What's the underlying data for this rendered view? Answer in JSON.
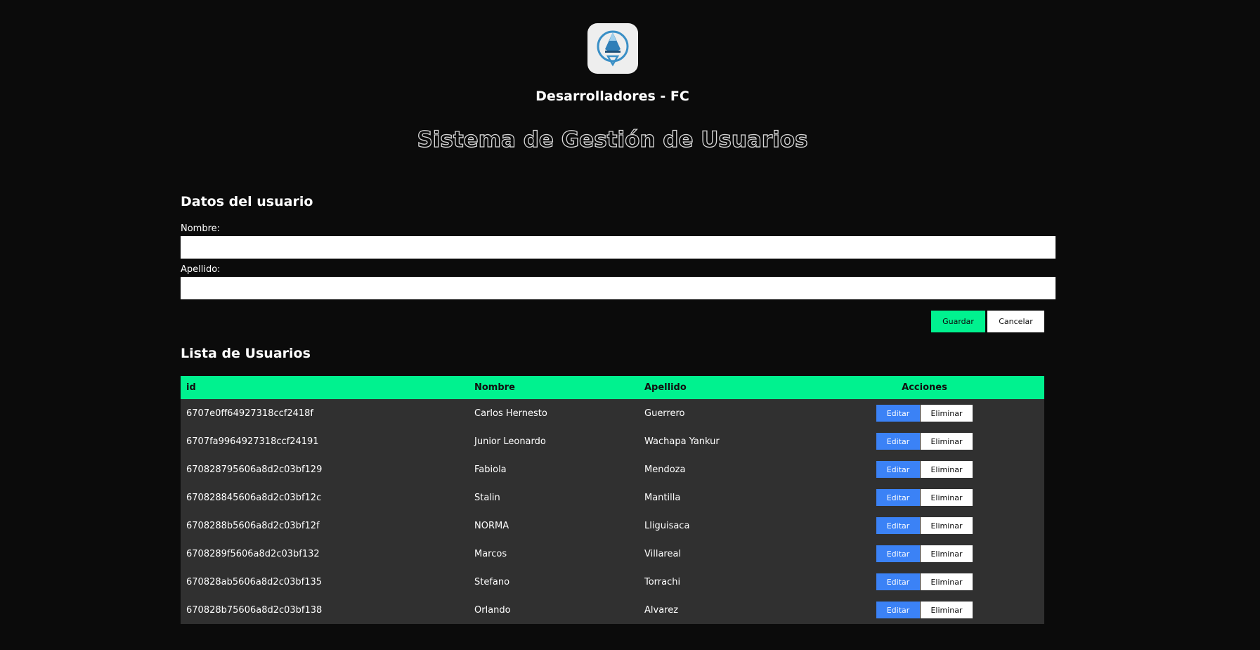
{
  "header": {
    "brand": "Desarrolladores - FC",
    "system_title": "Sistema de Gestión de Usuarios",
    "logo_icon": "droplet-shield-icon"
  },
  "form": {
    "title": "Datos del usuario",
    "nombre_label": "Nombre:",
    "nombre_value": "",
    "apellido_label": "Apellido:",
    "apellido_value": "",
    "save_label": "Guardar",
    "cancel_label": "Cancelar"
  },
  "list": {
    "title": "Lista de Usuarios",
    "columns": [
      "id",
      "Nombre",
      "Apellido",
      "Acciones"
    ],
    "edit_label": "Editar",
    "delete_label": "Eliminar",
    "rows": [
      {
        "id": "6707e0ff64927318ccf2418f",
        "nombre": "Carlos Hernesto",
        "apellido": "Guerrero"
      },
      {
        "id": "6707fa9964927318ccf24191",
        "nombre": "Junior Leonardo",
        "apellido": "Wachapa Yankur"
      },
      {
        "id": "670828795606a8d2c03bf129",
        "nombre": "Fabiola",
        "apellido": "Mendoza"
      },
      {
        "id": "670828845606a8d2c03bf12c",
        "nombre": "Stalin",
        "apellido": "Mantilla"
      },
      {
        "id": "6708288b5606a8d2c03bf12f",
        "nombre": "NORMA",
        "apellido": "Lliguisaca"
      },
      {
        "id": "6708289f5606a8d2c03bf132",
        "nombre": "Marcos",
        "apellido": "Villareal"
      },
      {
        "id": "670828ab5606a8d2c03bf135",
        "nombre": "Stefano",
        "apellido": "Torrachi"
      },
      {
        "id": "670828b75606a8d2c03bf138",
        "nombre": "Orlando",
        "apellido": "Alvarez"
      }
    ]
  },
  "colors": {
    "background": "#0b0b0b",
    "accent_green": "#00f28f",
    "edit_blue": "#3b82f6",
    "row_bg": "#303030"
  }
}
